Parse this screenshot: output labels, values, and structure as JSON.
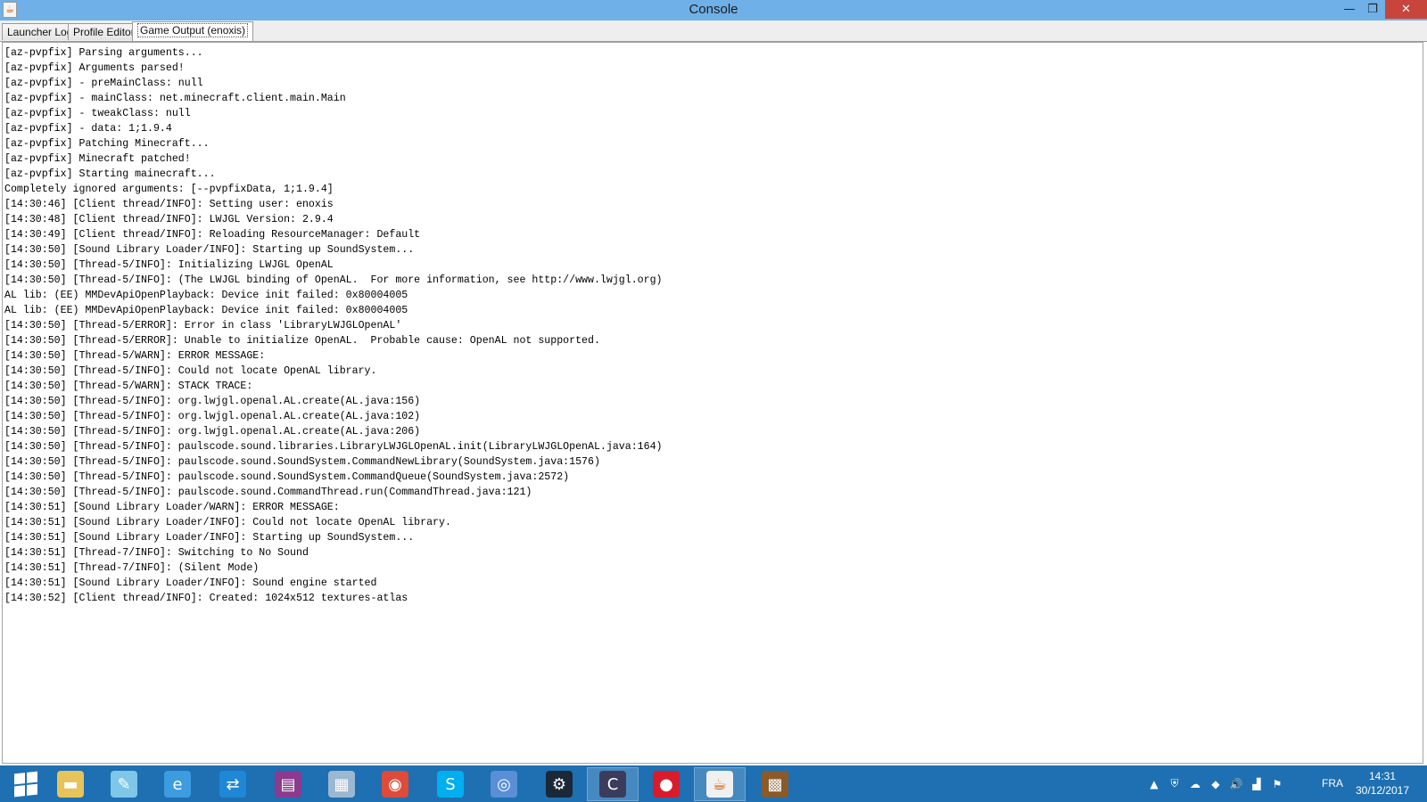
{
  "window": {
    "title": "Console",
    "icon": "java-icon",
    "minimize_glyph": "—",
    "maximize_glyph": "❐",
    "close_glyph": "✕"
  },
  "tabs": [
    {
      "label": "Launcher Log",
      "active": false
    },
    {
      "label": "Profile Editor",
      "active": false
    },
    {
      "label": "Game Output (enoxis)",
      "active": true
    }
  ],
  "console": {
    "lines": [
      "[az-pvpfix] Parsing arguments...",
      "[az-pvpfix] Arguments parsed!",
      "[az-pvpfix] - preMainClass: null",
      "[az-pvpfix] - mainClass: net.minecraft.client.main.Main",
      "[az-pvpfix] - tweakClass: null",
      "[az-pvpfix] - data: 1;1.9.4",
      "[az-pvpfix] Patching Minecraft...",
      "[az-pvpfix] Minecraft patched!",
      "[az-pvpfix] Starting mainecraft...",
      "Completely ignored arguments: [--pvpfixData, 1;1.9.4]",
      "[14:30:46] [Client thread/INFO]: Setting user: enoxis",
      "[14:30:48] [Client thread/INFO]: LWJGL Version: 2.9.4",
      "[14:30:49] [Client thread/INFO]: Reloading ResourceManager: Default",
      "[14:30:50] [Sound Library Loader/INFO]: Starting up SoundSystem...",
      "[14:30:50] [Thread-5/INFO]: Initializing LWJGL OpenAL",
      "[14:30:50] [Thread-5/INFO]: (The LWJGL binding of OpenAL.  For more information, see http://www.lwjgl.org)",
      "AL lib: (EE) MMDevApiOpenPlayback: Device init failed: 0x80004005",
      "AL lib: (EE) MMDevApiOpenPlayback: Device init failed: 0x80004005",
      "[14:30:50] [Thread-5/ERROR]: Error in class 'LibraryLWJGLOpenAL'",
      "[14:30:50] [Thread-5/ERROR]: Unable to initialize OpenAL.  Probable cause: OpenAL not supported.",
      "[14:30:50] [Thread-5/WARN]: ERROR MESSAGE:",
      "[14:30:50] [Thread-5/INFO]: Could not locate OpenAL library.",
      "[14:30:50] [Thread-5/WARN]: STACK TRACE:",
      "[14:30:50] [Thread-5/INFO]: org.lwjgl.openal.AL.create(AL.java:156)",
      "[14:30:50] [Thread-5/INFO]: org.lwjgl.openal.AL.create(AL.java:102)",
      "[14:30:50] [Thread-5/INFO]: org.lwjgl.openal.AL.create(AL.java:206)",
      "[14:30:50] [Thread-5/INFO]: paulscode.sound.libraries.LibraryLWJGLOpenAL.init(LibraryLWJGLOpenAL.java:164)",
      "[14:30:50] [Thread-5/INFO]: paulscode.sound.SoundSystem.CommandNewLibrary(SoundSystem.java:1576)",
      "[14:30:50] [Thread-5/INFO]: paulscode.sound.SoundSystem.CommandQueue(SoundSystem.java:2572)",
      "[14:30:50] [Thread-5/INFO]: paulscode.sound.CommandThread.run(CommandThread.java:121)",
      "[14:30:51] [Sound Library Loader/WARN]: ERROR MESSAGE:",
      "[14:30:51] [Sound Library Loader/INFO]: Could not locate OpenAL library.",
      "[14:30:51] [Sound Library Loader/INFO]: Starting up SoundSystem...",
      "[14:30:51] [Thread-7/INFO]: Switching to No Sound",
      "[14:30:51] [Thread-7/INFO]: (Silent Mode)",
      "[14:30:51] [Sound Library Loader/INFO]: Sound engine started",
      "[14:30:52] [Client thread/INFO]: Created: 1024x512 textures-atlas"
    ]
  },
  "taskbar": {
    "items": [
      {
        "icon": "start-windows-icon",
        "color": "#ffffff",
        "glyph": ""
      },
      {
        "icon": "file-explorer-icon",
        "color": "#e8c35a",
        "glyph": "▬"
      },
      {
        "icon": "notepad-icon",
        "color": "#7ec7e8",
        "glyph": "✎"
      },
      {
        "icon": "internet-explorer-icon",
        "color": "#3d9be0",
        "glyph": "e"
      },
      {
        "icon": "teamviewer-icon",
        "color": "#1e88d6",
        "glyph": "⇄"
      },
      {
        "icon": "winrar-icon",
        "color": "#8b3a8f",
        "glyph": "▤"
      },
      {
        "icon": "calculator-icon",
        "color": "#9bb8d0",
        "glyph": "▦"
      },
      {
        "icon": "chrome-icon",
        "color": "#de4b39",
        "glyph": "◉"
      },
      {
        "icon": "skype-icon",
        "color": "#00aff0",
        "glyph": "S"
      },
      {
        "icon": "chromium-icon",
        "color": "#5a8fd8",
        "glyph": "◎"
      },
      {
        "icon": "steam-icon",
        "color": "#1b2838",
        "glyph": "⚙"
      },
      {
        "icon": "launcher-icon",
        "color": "#3b3b5c",
        "glyph": "C"
      },
      {
        "icon": "record-icon",
        "color": "#d81c2b",
        "glyph": "●"
      },
      {
        "icon": "java-icon",
        "color": "#f0f0f0",
        "glyph": "☕"
      },
      {
        "icon": "minecraft-crafting-table-icon",
        "color": "#8a5a2b",
        "glyph": "▩"
      }
    ],
    "active_items": [
      "launcher-icon",
      "java-icon"
    ],
    "tray": {
      "icons": [
        "chevron-up-icon",
        "security-shield-icon",
        "onedrive-icon",
        "notification-icon",
        "volume-icon",
        "network-signal-icon",
        "flag-icon"
      ],
      "glyphs": [
        "▲",
        "⛨",
        "☁",
        "◆",
        "🔊",
        "▟",
        "⚑"
      ],
      "language": "FRA",
      "time": "14:31",
      "date": "30/12/2017"
    },
    "bar_color": "#1e70b3"
  }
}
